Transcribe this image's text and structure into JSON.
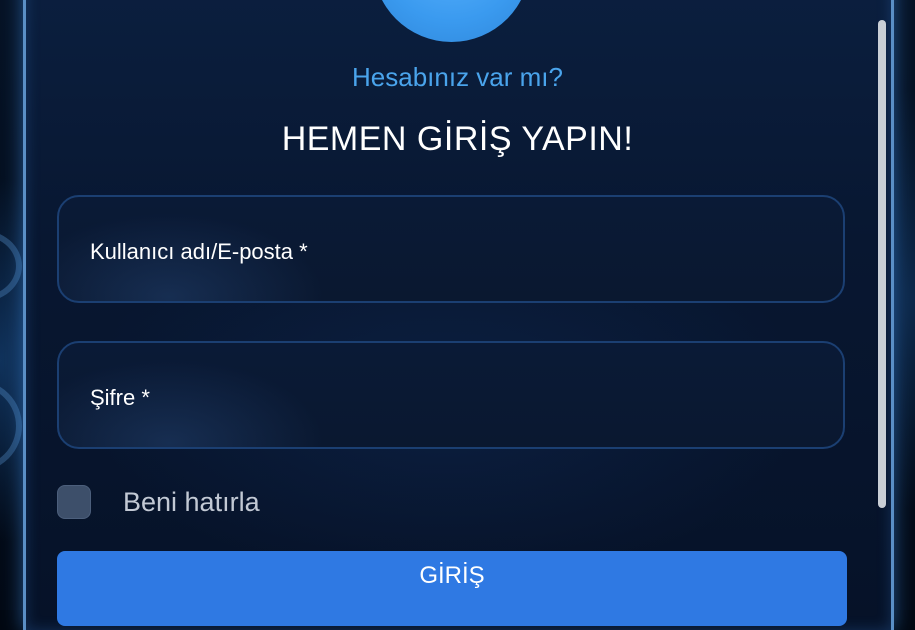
{
  "login": {
    "question": "Hesabınız var mı?",
    "heading": "HEMEN GİRİŞ YAPIN!",
    "username_label": "Kullanıcı adı/E-posta *",
    "password_label": "Şifre *",
    "remember_label": "Beni hatırla",
    "submit_label": "GİRİŞ"
  },
  "colors": {
    "accent_link": "#4aa4ec",
    "button": "#2f79e3",
    "background": "#081731"
  },
  "icons": {
    "avatar": "user-avatar-circle"
  }
}
